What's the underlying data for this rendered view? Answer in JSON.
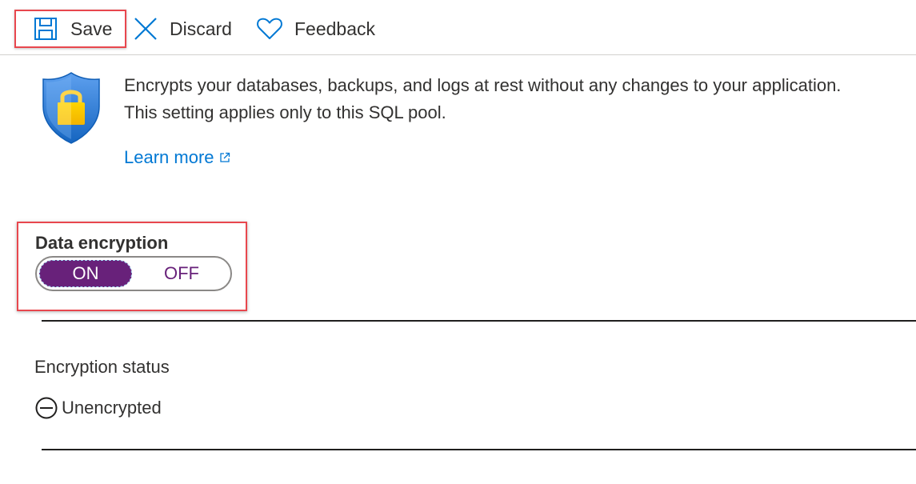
{
  "toolbar": {
    "save_label": "Save",
    "discard_label": "Discard",
    "feedback_label": "Feedback"
  },
  "info": {
    "description_line1": "Encrypts your databases, backups, and logs at rest without any changes to your application.",
    "description_line2": "This setting applies only to this SQL pool.",
    "learn_more": "Learn more"
  },
  "encryption": {
    "label": "Data encryption",
    "toggle_on": "ON",
    "toggle_off": "OFF",
    "selected": "ON"
  },
  "status": {
    "label": "Encryption status",
    "value": "Unencrypted"
  },
  "colors": {
    "accent": "#68217a",
    "link": "#0078d4",
    "highlight_border": "#e8474e"
  }
}
